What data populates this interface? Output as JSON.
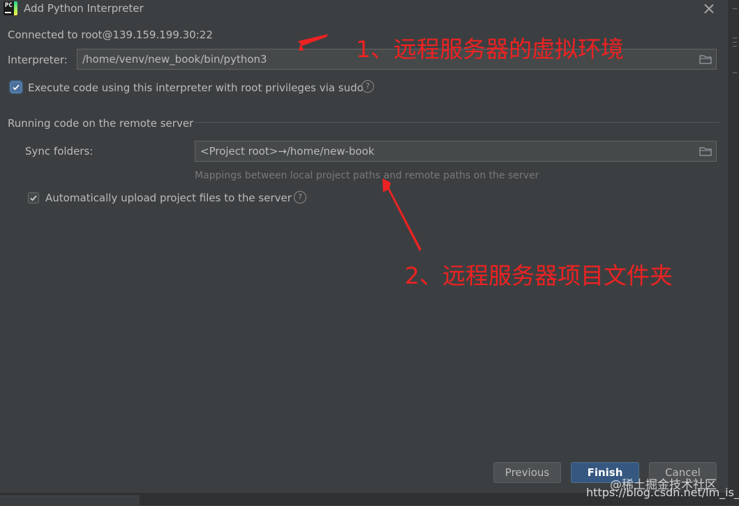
{
  "window": {
    "title": "Add Python Interpreter"
  },
  "connection": {
    "text": "Connected to root@139.159.199.30:22"
  },
  "interpreter": {
    "label": "Interpreter:",
    "value": "/home/venv/new_book/bin/python3"
  },
  "sudo_option": {
    "label": "Execute code using this interpreter with root privileges via sudo",
    "checked": true
  },
  "remote_section": {
    "title": "Running code on the remote server"
  },
  "sync": {
    "label": "Sync folders:",
    "value": "<Project root>→/home/new-book",
    "hint": "Mappings between local project paths and remote paths on the server"
  },
  "upload_option": {
    "label": "Automatically upload project files to the server",
    "checked": true
  },
  "buttons": {
    "previous": "Previous",
    "finish": "Finish",
    "cancel": "Cancel"
  },
  "annotations": {
    "note1": "1、远程服务器的虚拟环境",
    "note2": "2、远程服务器项目文件夹",
    "color": "#ee2222"
  },
  "watermark": {
    "line1": "@稀土掘金技术社区",
    "line2": "https://blog.csdn.net/lm_is_dc"
  },
  "icons": {
    "app": "pycharm-icon",
    "folder": "folder-icon",
    "help": "help-icon",
    "close": "close-icon"
  },
  "colors": {
    "background": "#3c3f41",
    "field": "#45494a",
    "accent": "#365880"
  }
}
